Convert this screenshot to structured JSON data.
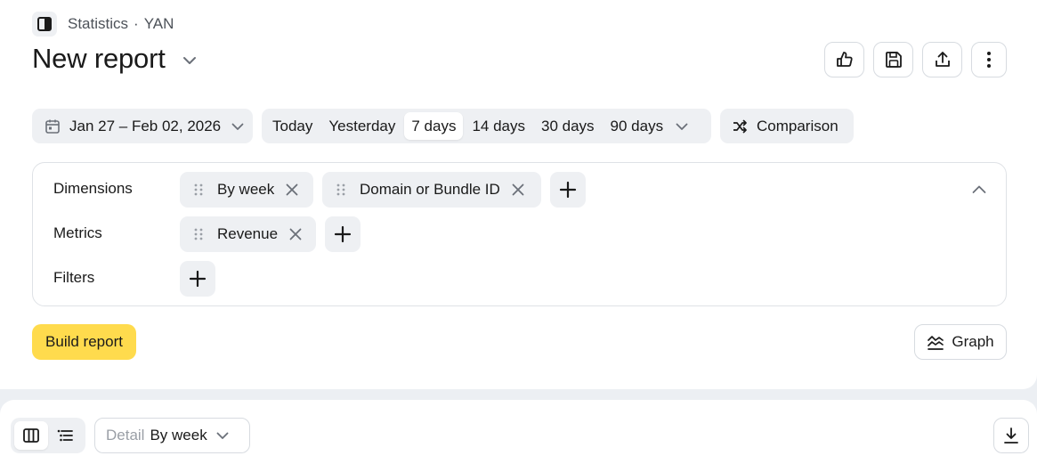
{
  "breadcrumb": {
    "section": "Statistics",
    "separator": "·",
    "product": "YAN"
  },
  "report": {
    "title": "New report"
  },
  "header_actions": [
    {
      "name": "like-icon"
    },
    {
      "name": "save-icon"
    },
    {
      "name": "share-icon"
    },
    {
      "name": "more-icon"
    }
  ],
  "date_range": {
    "label": "Jan 27 – Feb 02, 2026"
  },
  "periods": {
    "items": [
      "Today",
      "Yesterday",
      "7 days",
      "14 days",
      "30 days",
      "90 days"
    ],
    "selected": "7 days"
  },
  "comparison": {
    "label": "Comparison"
  },
  "config": {
    "dimensions_label": "Dimensions",
    "dimensions": [
      "By week",
      "Domain or Bundle ID"
    ],
    "metrics_label": "Metrics",
    "metrics": [
      "Revenue"
    ],
    "filters_label": "Filters"
  },
  "actions": {
    "build_label": "Build report",
    "graph_label": "Graph"
  },
  "table_toolbar": {
    "detail_label": "Detail",
    "detail_value": "By week"
  },
  "colors": {
    "accent": "#ffdb4d",
    "chip_bg": "#eef0f3",
    "page_bg": "#eceff3"
  }
}
